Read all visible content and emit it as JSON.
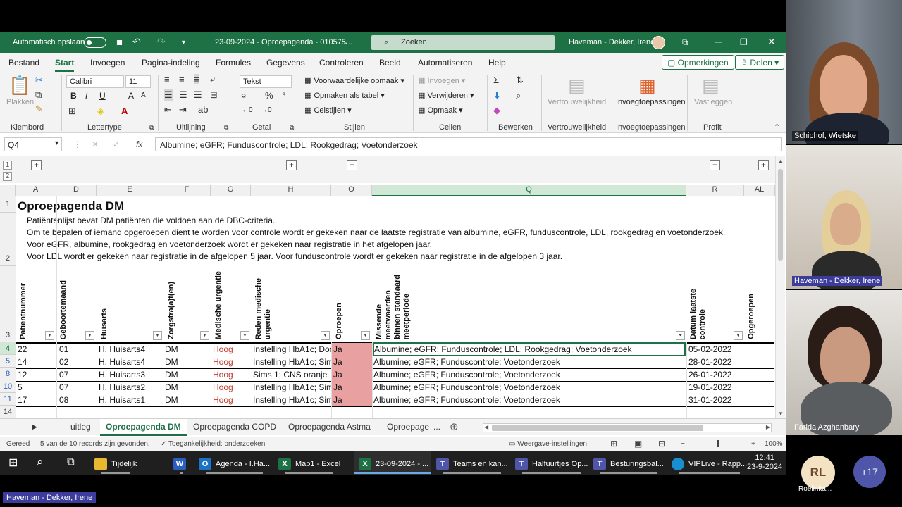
{
  "titlebar": {
    "autosave_label": "Automatisch opslaan",
    "doc_title": "23-09-2024 - Oproepagenda - 010575...",
    "search_placeholder": "Zoeken",
    "user": "Haveman - Dekker, Irene"
  },
  "menu": {
    "items": [
      "Bestand",
      "Start",
      "Invoegen",
      "Pagina-indeling",
      "Formules",
      "Gegevens",
      "Controleren",
      "Beeld",
      "Automatiseren",
      "Help"
    ],
    "active": "Start",
    "comments": "Opmerkingen",
    "share": "Delen"
  },
  "ribbon": {
    "paste": "Plakken",
    "font_name": "Calibri",
    "font_size": "11",
    "number_format": "Tekst",
    "conditional": "Voorwaardelijke opmaak",
    "format_table": "Opmaken als tabel",
    "cell_styles": "Celstijlen",
    "insert": "Invoegen",
    "delete": "Verwijderen",
    "format": "Opmaak",
    "sensitivity": "Vertrouwelijkheid",
    "addins": "Invoegtoepassingen",
    "pin": "Vastleggen",
    "groups": {
      "clipboard": "Klembord",
      "font": "Lettertype",
      "alignment": "Uitlijning",
      "number": "Getal",
      "styles": "Stijlen",
      "cells": "Cellen",
      "editing": "Bewerken",
      "sensitivity": "Vertrouwelijkheid",
      "addins": "Invoegtoepassingen",
      "profit": "Profit"
    }
  },
  "formula_bar": {
    "name_box": "Q4",
    "fx": "fx",
    "content": "Albumine; eGFR; Funduscontrole; LDL; Rookgedrag; Voetonderzoek"
  },
  "outline": {
    "levels": [
      "1",
      "2"
    ]
  },
  "columns": [
    "A",
    "D",
    "E",
    "F",
    "G",
    "H",
    "O",
    "Q",
    "R",
    "AL"
  ],
  "row_numbers": [
    "1",
    "2",
    "3",
    "4",
    "5",
    "8",
    "10",
    "11",
    "14"
  ],
  "sheet": {
    "title": "Oproepagenda DM",
    "description": [
      "Patiëntenlijst bevat DM patiënten die voldoen aan de DBC-criteria.",
      "Om te bepalen of iemand opgeroepen dient te worden voor controle wordt er gekeken naar de laatste registratie van albumine, eGFR, funduscontrole, LDL, rookgedrag en voetonderzoek.",
      "Voor eGFR, albumine, rookgedrag en voetonderzoek wordt er gekeken naar registratie in het afgelopen jaar.",
      "Voor LDL wordt er gekeken naar registratie in de afgelopen 5 jaar. Voor funduscontrole wordt er gekeken naar registratie in de afgelopen 3 jaar."
    ],
    "headers": {
      "A": "Patientnummer",
      "D": "Geboortemaand",
      "E": "Huisarts",
      "F": "Zorgstra(a)t(en)",
      "G": "Medische urgentie",
      "H1": "Reden medische",
      "H2": "urgentie",
      "O": "Oproepen",
      "Q1": "Missende",
      "Q2": "meetwaarden",
      "Q3": "binnen standaard",
      "Q4": "meetperiode",
      "R1": "Datum laatste",
      "R2": "controle",
      "AL": "Opgeroepen"
    },
    "rows": [
      {
        "a": "22",
        "d": "01",
        "e": "H. Huisarts4",
        "f": "DM",
        "g": "Hoog",
        "h": "Instelling HbA1c; Doo",
        "o": "Ja",
        "q": "Albumine; eGFR; Funduscontrole; LDL; Rookgedrag; Voetonderzoek",
        "r": "05-02-2022"
      },
      {
        "a": "14",
        "d": "02",
        "e": "H. Huisarts4",
        "f": "DM",
        "g": "Hoog",
        "h": "Instelling HbA1c; Sim",
        "o": "Ja",
        "q": "Albumine; eGFR; Funduscontrole; Voetonderzoek",
        "r": "28-01-2022"
      },
      {
        "a": "12",
        "d": "07",
        "e": "H. Huisarts3",
        "f": "DM",
        "g": "Hoog",
        "h": "Sims 1; CNS oranje",
        "o": "Ja",
        "q": "Albumine; eGFR; Funduscontrole; Voetonderzoek",
        "r": "26-01-2022"
      },
      {
        "a": "5",
        "d": "07",
        "e": "H. Huisarts2",
        "f": "DM",
        "g": "Hoog",
        "h": "Instelling HbA1c; Sim",
        "o": "Ja",
        "q": "Albumine; eGFR; Funduscontrole; Voetonderzoek",
        "r": "19-01-2022"
      },
      {
        "a": "17",
        "d": "08",
        "e": "H. Huisarts1",
        "f": "DM",
        "g": "Hoog",
        "h": "Instelling HbA1c; Sim",
        "o": "Ja",
        "q": "Albumine; eGFR; Funduscontrole; Voetonderzoek",
        "r": "31-01-2022"
      }
    ]
  },
  "tabs": [
    "uitleg",
    "Oproepagenda DM",
    "Oproepagenda COPD",
    "Oproepagenda Astma",
    "Oproepage",
    "..."
  ],
  "status": {
    "ready": "Gereed",
    "records": "5 van de 10 records zijn gevonden.",
    "accessibility": "Toegankelijkheid: onderzoeken",
    "display_settings": "Weergave-instellingen",
    "zoom": "100%"
  },
  "taskbar": {
    "items": [
      "Tijdelijk",
      "Agenda - I.Ha...",
      "Map1 - Excel",
      "23-09-2024 - ...",
      "Teams en kan...",
      "Halfuurtjes Op...",
      "Besturingsbal...",
      "VIPLive - Rapp..."
    ],
    "time": "12:41",
    "date": "23-9-2024"
  },
  "participants": {
    "p1": "Schiphof, Wietske",
    "p2": "Haveman - Dekker, Irene",
    "p3": "Farida Azghanbary",
    "initials": "RL",
    "p4": "Roelinka...",
    "more": "+17",
    "presenter": "Haveman - Dekker, Irene"
  },
  "colors": {
    "excel_green": "#1e7145",
    "urgent_red": "#c0392b",
    "ja_fill": "#e8a0a0"
  }
}
